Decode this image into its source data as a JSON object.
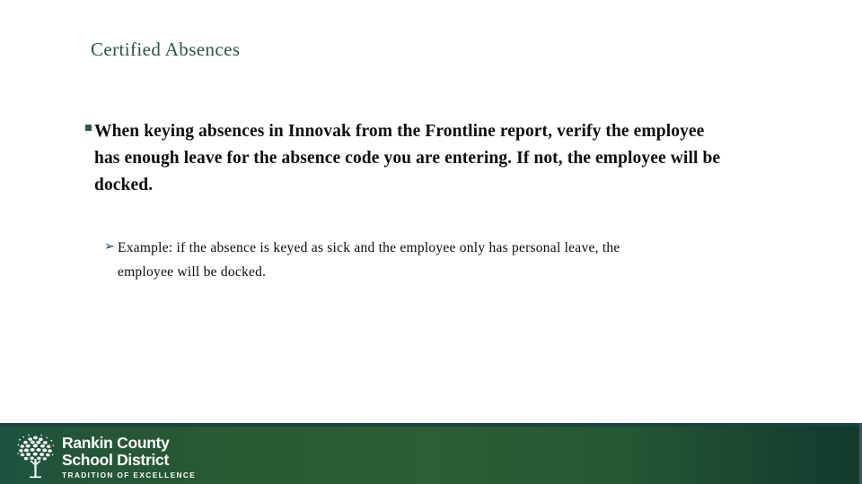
{
  "slide": {
    "title": "Certified Absences",
    "title_color": "#2f5246",
    "background_color": "#ffffff"
  },
  "body": {
    "bullets": [
      {
        "level": 1,
        "marker": "square-bullet",
        "marker_color": "#2e5941",
        "text": "When keying absences in Innovak from the Frontline report, verify the employee has enough leave for the absence code you are entering.   If not, the employee will be docked."
      },
      {
        "level": 2,
        "marker": "➢",
        "marker_name": "arrow-bullet",
        "marker_color": "#1f3c52",
        "text": "Example:  if the absence is keyed as sick and the employee only has personal leave, the employee will be docked."
      }
    ]
  },
  "footer": {
    "band_colors": {
      "left": "#1d5340",
      "center": "#2c5f33",
      "right": "#123a2e",
      "top_line": "#1d4245",
      "right_line": "#3b5668"
    },
    "logo": {
      "icon": "tree-logo",
      "line1": "Rankin County",
      "line2": "School District",
      "tagline": "TRADITION OF EXCELLENCE"
    }
  }
}
